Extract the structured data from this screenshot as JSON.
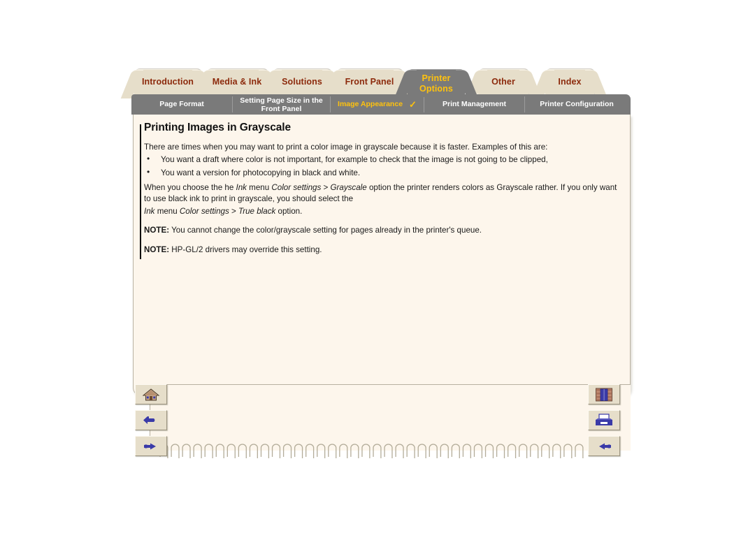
{
  "main_tabs": [
    {
      "label": "Introduction",
      "active": false
    },
    {
      "label": "Media & Ink",
      "active": false
    },
    {
      "label": "Solutions",
      "active": false
    },
    {
      "label": "Front Panel",
      "active": false
    },
    {
      "label": "Printer Options",
      "active": true,
      "line1": "Printer",
      "line2": "Options"
    },
    {
      "label": "Other",
      "active": false
    },
    {
      "label": "Index",
      "active": false
    }
  ],
  "sub_tabs": [
    {
      "label": "Page Format",
      "selected": false,
      "check": ""
    },
    {
      "label": "Setting Page Size in the Front Panel",
      "selected": false,
      "check": "",
      "line1": "Setting Page Size in the",
      "line2": "Front Panel"
    },
    {
      "label": "Image Appearance",
      "selected": true,
      "check": "✓"
    },
    {
      "label": "Print Management",
      "selected": false,
      "check": ""
    },
    {
      "label": "Printer Configuration",
      "selected": false,
      "check": ""
    }
  ],
  "page": {
    "title": "Printing Images in Grayscale",
    "intro": "There are times when you may want to print a color image in grayscale because it is faster. Examples of this are:",
    "bullets": [
      "You want a draft where color is not important, for example to check that the image is not going to be clipped,",
      "You want a version for photocopying in black and white."
    ],
    "body_p1_a": "When you choose the he ",
    "body_p1_ink": "Ink",
    "body_p1_b": " menu ",
    "body_p1_color": "Color settings",
    "body_p1_c": " > ",
    "body_p1_gray": "Grayscale",
    "body_p1_d": " option the printer renders colors as Grayscale rather. If you only want to use black ink to print in grayscale, you should select the",
    "body_p2_ink": "Ink",
    "body_p2_a": " menu ",
    "body_p2_color": "Color settings",
    "body_p2_b": " > ",
    "body_p2_true": "True black",
    "body_p2_c": " option.",
    "note1_label": "NOTE:",
    "note1_text": " You cannot change the color/grayscale setting for pages already in the printer's queue.",
    "note2_label": "NOTE:",
    "note2_text": " HP-GL/2 drivers may override this setting."
  },
  "nav_left": [
    {
      "icon": "home-icon"
    },
    {
      "icon": "back-arrow-icon"
    },
    {
      "icon": "hand-pointing-right-icon"
    }
  ],
  "nav_right": [
    {
      "icon": "bookshelf-icon"
    },
    {
      "icon": "printer-icon"
    },
    {
      "icon": "hand-pointing-left-icon"
    }
  ],
  "colors": {
    "tab_bg": "#E6DECA",
    "tab_text": "#8C2A0C",
    "active_tab_bg": "#7A7A7A",
    "active_tab_text": "#FFC20E",
    "page_bg": "#FDF6EC",
    "sub_tab_text": "#FFFFFF",
    "sub_tab_selected": "#FFC20E",
    "icon_blue": "#3A3AA8"
  }
}
